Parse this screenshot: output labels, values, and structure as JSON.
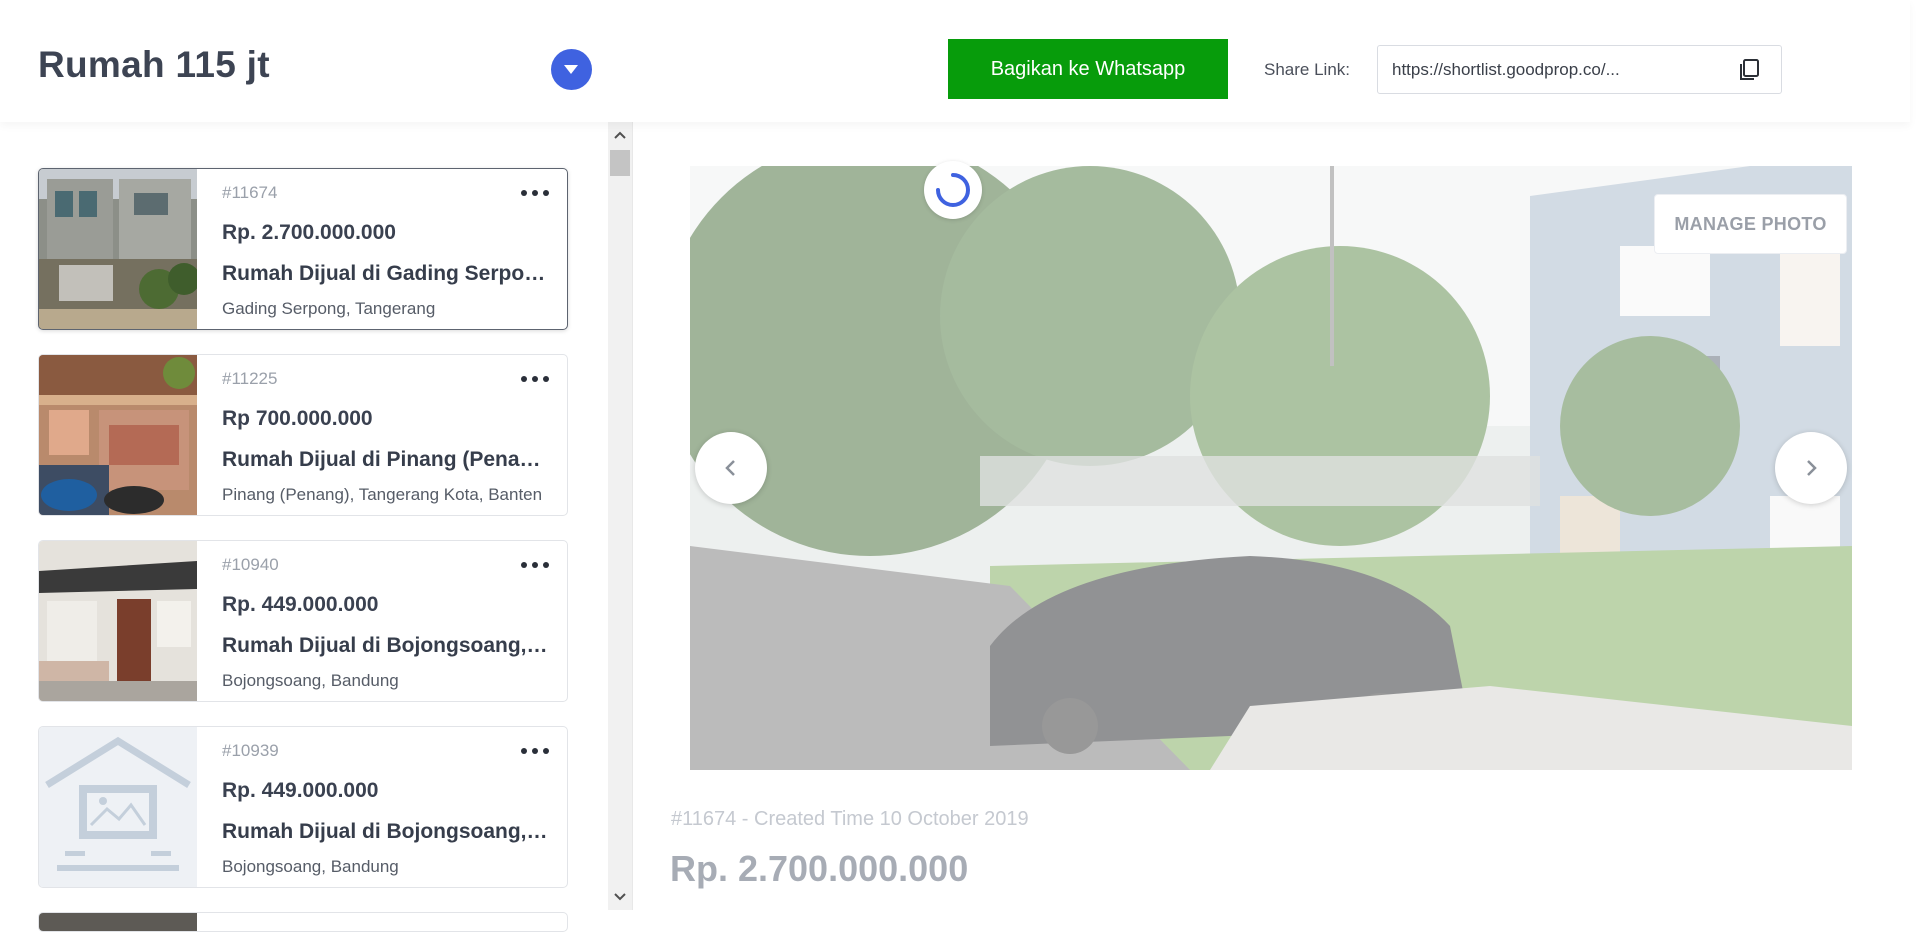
{
  "header": {
    "title": "Rumah 115 jt",
    "share_whatsapp_label": "Bagikan ke Whatsapp",
    "share_link_label": "Share Link:",
    "share_link_value": "https://shortlist.goodprop.co/..."
  },
  "listings": [
    {
      "id": "#11674",
      "price": "Rp. 2.700.000.000",
      "title": "Rumah Dijual di Gading Serpong, Tangerang",
      "location": "Gading Serpong, Tangerang",
      "selected": true
    },
    {
      "id": "#11225",
      "price": "Rp 700.000.000",
      "title": "Rumah Dijual di Pinang (Penang), Tangerang Kota",
      "location": "Pinang (Penang), Tangerang Kota, Banten",
      "selected": false
    },
    {
      "id": "#10940",
      "price": "Rp. 449.000.000",
      "title": "Rumah Dijual di Bojongsoang, Bandung",
      "location": "Bojongsoang, Bandung",
      "selected": false
    },
    {
      "id": "#10939",
      "price": "Rp. 449.000.000",
      "title": "Rumah Dijual di Bojongsoang, Bandung",
      "location": "Bojongsoang, Bandung",
      "selected": false
    }
  ],
  "detail": {
    "manage_photo_label": "MANAGE PHOTO",
    "meta": "#11674 - Created Time 10 October 2019",
    "price": "Rp. 2.700.000.000"
  },
  "icons": {
    "title_dropdown": "chevron-down-icon",
    "copy": "copy-icon",
    "more": "more-horizontal-icon",
    "prev": "chevron-left-icon",
    "next": "chevron-right-icon",
    "loading": "spinner-icon"
  },
  "colors": {
    "whatsapp_button": "#079c0b",
    "accent": "#3f62e0",
    "text_dark": "#3d4453"
  }
}
